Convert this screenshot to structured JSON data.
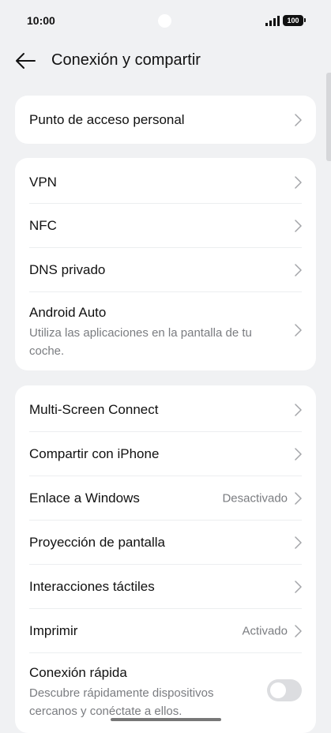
{
  "status": {
    "time": "10:00",
    "battery": "100"
  },
  "header": {
    "title": "Conexión y compartir"
  },
  "group1": [
    {
      "label": "Punto de acceso personal"
    }
  ],
  "group2": [
    {
      "label": "VPN"
    },
    {
      "label": "NFC"
    },
    {
      "label": "DNS privado"
    },
    {
      "label": "Android Auto",
      "subtitle": "Utiliza las aplicaciones en la pantalla de tu coche."
    }
  ],
  "group3": [
    {
      "label": "Multi-Screen Connect"
    },
    {
      "label": "Compartir con iPhone"
    },
    {
      "label": "Enlace a Windows",
      "value": "Desactivado"
    },
    {
      "label": "Proyección de pantalla"
    },
    {
      "label": "Interacciones táctiles"
    },
    {
      "label": "Imprimir",
      "value": "Activado"
    },
    {
      "label": "Conexión rápida",
      "subtitle": "Descubre rápidamente dispositivos cercanos y conéctate a ellos.",
      "toggle_on": false
    }
  ]
}
